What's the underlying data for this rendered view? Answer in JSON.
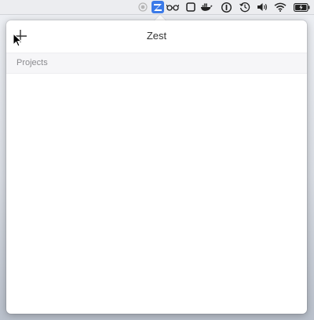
{
  "app": {
    "title": "Zest",
    "add_label": "+"
  },
  "sidebar": {
    "section_label": "Projects",
    "items": []
  },
  "menubar": {
    "icons": [
      "record-icon",
      "zest-app-icon",
      "glasses-icon",
      "square-icon",
      "docker-icon",
      "onepassword-icon",
      "time-machine-icon",
      "volume-icon",
      "wifi-icon",
      "battery-icon"
    ],
    "active_color": "#3b7ae8"
  }
}
